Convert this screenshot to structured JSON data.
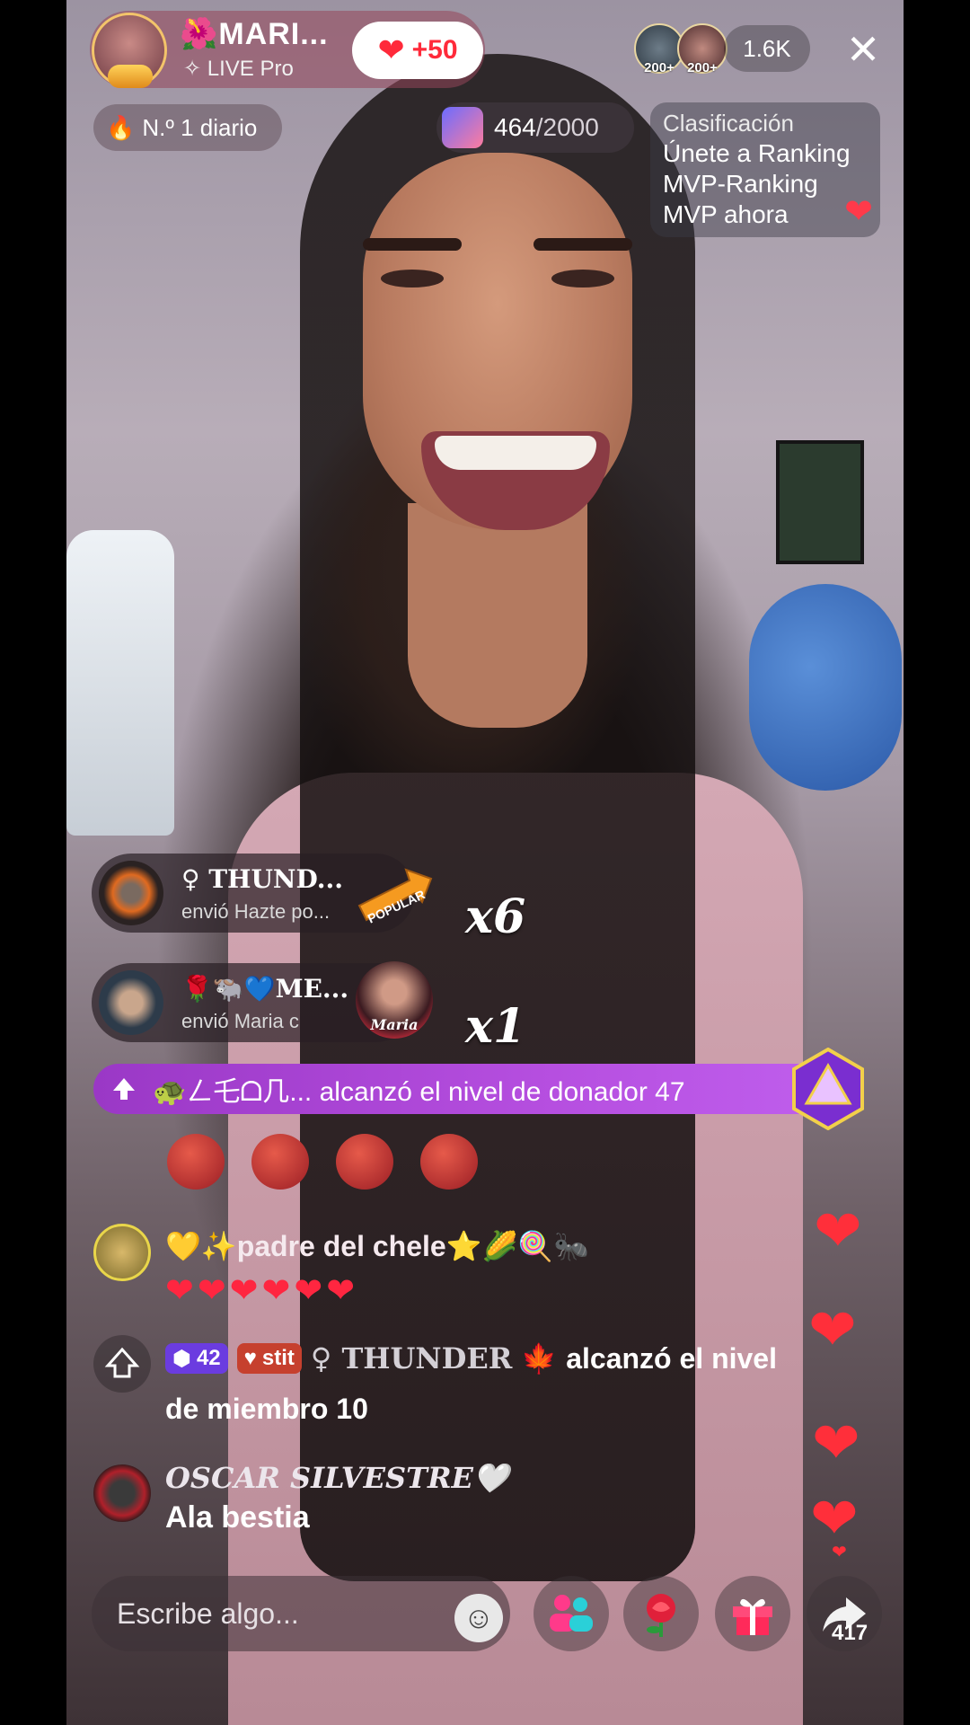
{
  "host": {
    "name": "MARI...",
    "subtitle": "LIVE Pro",
    "like_label": "+50"
  },
  "viewers": {
    "top1_label": "200+",
    "top2_label": "200+",
    "count": "1.6K"
  },
  "rank": {
    "label": "N.º 1 diario"
  },
  "goal": {
    "current": "464",
    "total": "/2000"
  },
  "ranking": {
    "title": "Clasificación",
    "line1": "Únete a Ranking",
    "line2": "MVP-Ranking",
    "line3": "MVP ahora"
  },
  "gifts": [
    {
      "name": "♀ THUND...",
      "message": "envió Hazte po...",
      "count": "x6",
      "gift_label": "POPULAR"
    },
    {
      "name": "🌹🐃💙ME...",
      "message": "envió Maria c",
      "count": "x1",
      "gift_label": "Maria"
    }
  ],
  "level_banner": {
    "text": "🐢ㄥ乇ᗝ几... alcanzó el nivel de donador 47"
  },
  "chat": [
    {
      "name": "💛✨padre del chele⭐🌽🍭🐜",
      "hearts": "❤❤❤❤❤❤"
    },
    {
      "level_badge": "42",
      "fan_badge": "stit",
      "user": "♀ THUNDER",
      "emoji": "🍁",
      "text": " alcanzó el nivel",
      "text2": "de miembro 10"
    },
    {
      "name": "OSCAR SILVESTRE🤍",
      "message": "Ala bestia"
    }
  ],
  "bottom": {
    "input_placeholder": "Escribe algo...",
    "share_count": "417"
  },
  "colors": {
    "accent_red": "#ff2a3a",
    "level_purple": "#b64fe0"
  }
}
